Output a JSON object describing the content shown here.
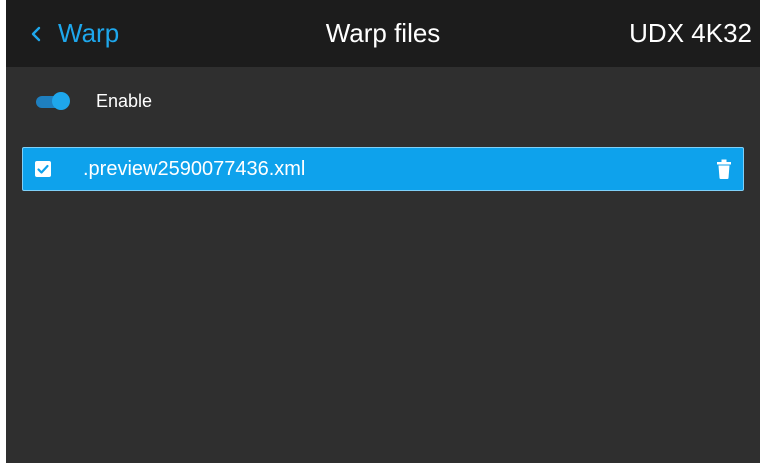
{
  "header": {
    "back_label": "Warp",
    "title": "Warp files",
    "model": "UDX 4K32"
  },
  "enable_toggle": {
    "label": "Enable",
    "state": "on"
  },
  "files": [
    {
      "name": ".preview2590077436.xml",
      "checked": true,
      "selected": true
    }
  ],
  "icons": {
    "back": "chevron-left-icon",
    "checkbox": "checkbox-checked-icon",
    "delete": "trash-icon"
  },
  "colors": {
    "accent": "#1ea7ec",
    "selection": "#0ea2ec",
    "header_bg": "#1c1c1c",
    "content_bg": "#2f2f2f"
  }
}
